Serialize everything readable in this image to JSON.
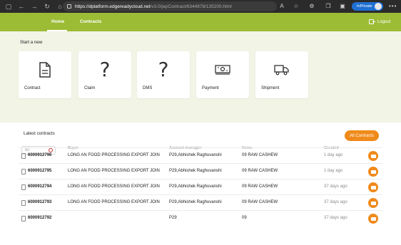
{
  "browser": {
    "url_host": "https://dplatform.edgereadycloud.net",
    "url_path": "/v3.0/pq/Contract/6344878/135200.html",
    "inprivate_label": "InPrivate"
  },
  "nav": {
    "home": "Home",
    "contracts": "Contracts",
    "logout": "Logout"
  },
  "start": {
    "label": "Start a new",
    "cards": [
      "Contract",
      "Claim",
      "DMS",
      "Payment",
      "Shipment"
    ]
  },
  "latest": {
    "title": "Latest contracts",
    "all_button": "All Contracts",
    "search_placeholder": "ID",
    "columns": [
      "Buyer",
      "Account manager",
      "Items",
      "Created"
    ],
    "rows": [
      {
        "id": "6000912796",
        "buyer": "LONG AN FOOD PROCESSING EXPORT JOIN",
        "manager": "P29,Abhishek Raghuvanshi",
        "items": "09 RAW CASHEW",
        "created": "1 day ago"
      },
      {
        "id": "6000912795",
        "buyer": "LONG AN FOOD PROCESSING EXPORT JOIN",
        "manager": "P29,Abhishek Raghuvanshi",
        "items": "09 RAW CASHEW",
        "created": "1 day ago"
      },
      {
        "id": "6000912794",
        "buyer": "LONG AN FOOD PROCESSING EXPORT JOIN",
        "manager": "P29,Abhishek Raghuvanshi",
        "items": "09 RAW CASHEW",
        "created": "37 days ago"
      },
      {
        "id": "6000912793",
        "buyer": "LONG AN FOOD PROCESSING EXPORT JOIN",
        "manager": "P29,Abhishek Raghuvanshi",
        "items": "09 RAW CASHEW",
        "created": "37 days ago"
      },
      {
        "id": "6000912792",
        "buyer": "",
        "manager": "P29",
        "items": "09",
        "created": "37 days ago"
      }
    ]
  },
  "colors": {
    "nav_green": "#9cbc36",
    "accent_orange": "#f08a1b"
  }
}
